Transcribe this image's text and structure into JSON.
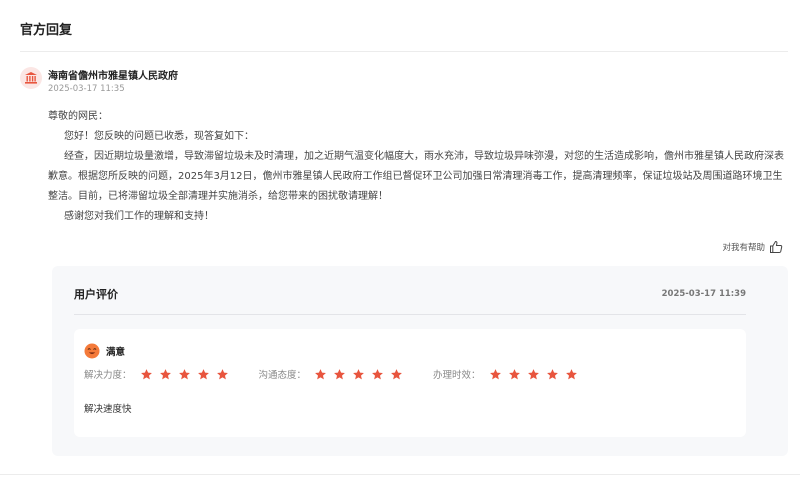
{
  "section": {
    "title": "官方回复"
  },
  "reply": {
    "org_name": "海南省儋州市雅星镇人民政府",
    "time": "2025-03-17 11:35",
    "icon": "government-building-icon",
    "paragraphs": [
      "尊敬的网民：",
      "您好！您反映的问题已收悉，现答复如下：",
      "经查，因近期垃圾量激增，导致滞留垃圾未及时清理，加之近期气温变化幅度大，雨水充沛，导致垃圾异味弥漫，对您的生活造成影响，儋州市雅星镇人民政府深表歉意。根据您所反映的问题，2025年3月12日，儋州市雅星镇人民政府工作组已督促环卫公司加强日常清理消毒工作，提高清理频率，保证垃圾站及周围道路环境卫生整洁。目前，已将滞留垃圾全部清理并实施消杀，给您带来的困扰敬请理解！",
      "感谢您对我们工作的理解和支持！"
    ]
  },
  "helpful": {
    "label": "对我有帮助",
    "icon": "thumbs-up-icon"
  },
  "evaluation": {
    "title": "用户评价",
    "time": "2025-03-17 11:39",
    "mood": "满意",
    "mood_icon": "smiley-face-icon",
    "ratings": [
      {
        "label": "解决力度：",
        "stars": 5
      },
      {
        "label": "沟通态度：",
        "stars": 5
      },
      {
        "label": "办理时效：",
        "stars": 5
      }
    ],
    "comment": "解决速度快"
  },
  "colors": {
    "accent": "#e8553e",
    "mood_face": "#f47a3a",
    "panel_bg": "#f7f8fa"
  }
}
